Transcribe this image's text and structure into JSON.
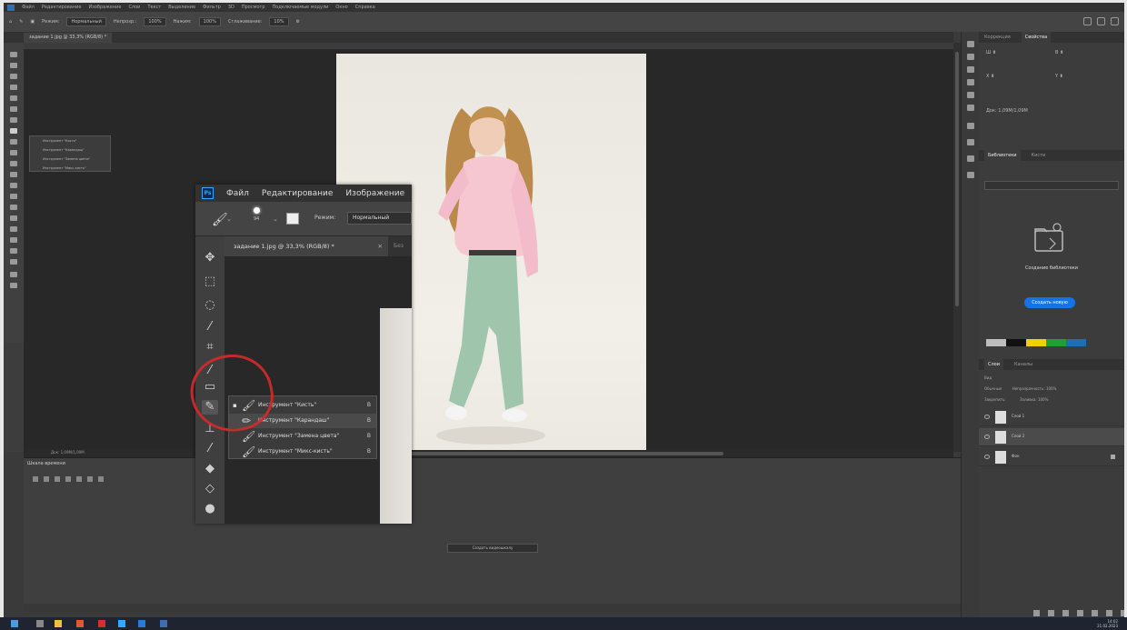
{
  "app": {
    "menubar_items": [
      "Файл",
      "Редактирование",
      "Изображение",
      "Слои",
      "Текст",
      "Выделение",
      "Фильтр",
      "3D",
      "Просмотр",
      "Подключаемые модули",
      "Окно",
      "Справка"
    ]
  },
  "options": {
    "mode_label": "Режим:",
    "mode_value": "Нормальный",
    "opacity_label": "Непрозр.:",
    "opacity_value": "100%",
    "flow_label": "Нажим:",
    "flow_value": "100%",
    "smooth_label": "Сглаживание:",
    "smooth_value": "10%"
  },
  "document": {
    "tab_title": "задание 1.jpg @ 33,3% (RGB/8) *",
    "tab_second": "Без"
  },
  "inset": {
    "logo": "Ps",
    "menu": [
      "Файл",
      "Редактирование",
      "Изображение"
    ],
    "brush_size": "94",
    "mode_label": "Режим:",
    "mode_value": "Нормальный",
    "flyout": [
      {
        "label": "Инструмент \"Кисть\"",
        "key": "B",
        "selected": true
      },
      {
        "label": "Инструмент \"Карандаш\"",
        "key": "B",
        "selected": false
      },
      {
        "label": "Инструмент \"Замена цвета\"",
        "key": "B",
        "selected": false
      },
      {
        "label": "Инструмент \"Микс-кисть\"",
        "key": "B",
        "selected": false
      }
    ]
  },
  "panels": {
    "properties_tabs": [
      "Коррекция",
      "Свойства"
    ],
    "doc_label": "Док: 1,09М/1,09М",
    "libraries_tabs": [
      "Библиотеки",
      "Кисти"
    ],
    "libraries_title": "Создание библиотеки",
    "libraries_button": "Создать новую",
    "layers_tabs": [
      "Слои",
      "Каналы"
    ],
    "layers_kind": "Вид",
    "layers_mode": "Обычные",
    "layers_opacity": "Непрозрачность: 100%",
    "layers_lock": "Закрепить:",
    "layers_fill": "Заливка: 100%",
    "layers": [
      "Слой 1",
      "Слой 2",
      "Фон"
    ]
  },
  "timeline": {
    "tab": "Шкала времени",
    "create_button": "Создать видеошкалу"
  },
  "colors": {
    "foreground": "#2ecc71",
    "background": "#c0392b",
    "accent": "#1473e6",
    "annotation": "#d42a2a",
    "swatches": [
      "#bdbdbd",
      "#111111",
      "#f1d200",
      "#1f9e3a",
      "#1c6fb5"
    ]
  },
  "tray": {
    "time": "14:02",
    "date": "21.02.2023"
  }
}
